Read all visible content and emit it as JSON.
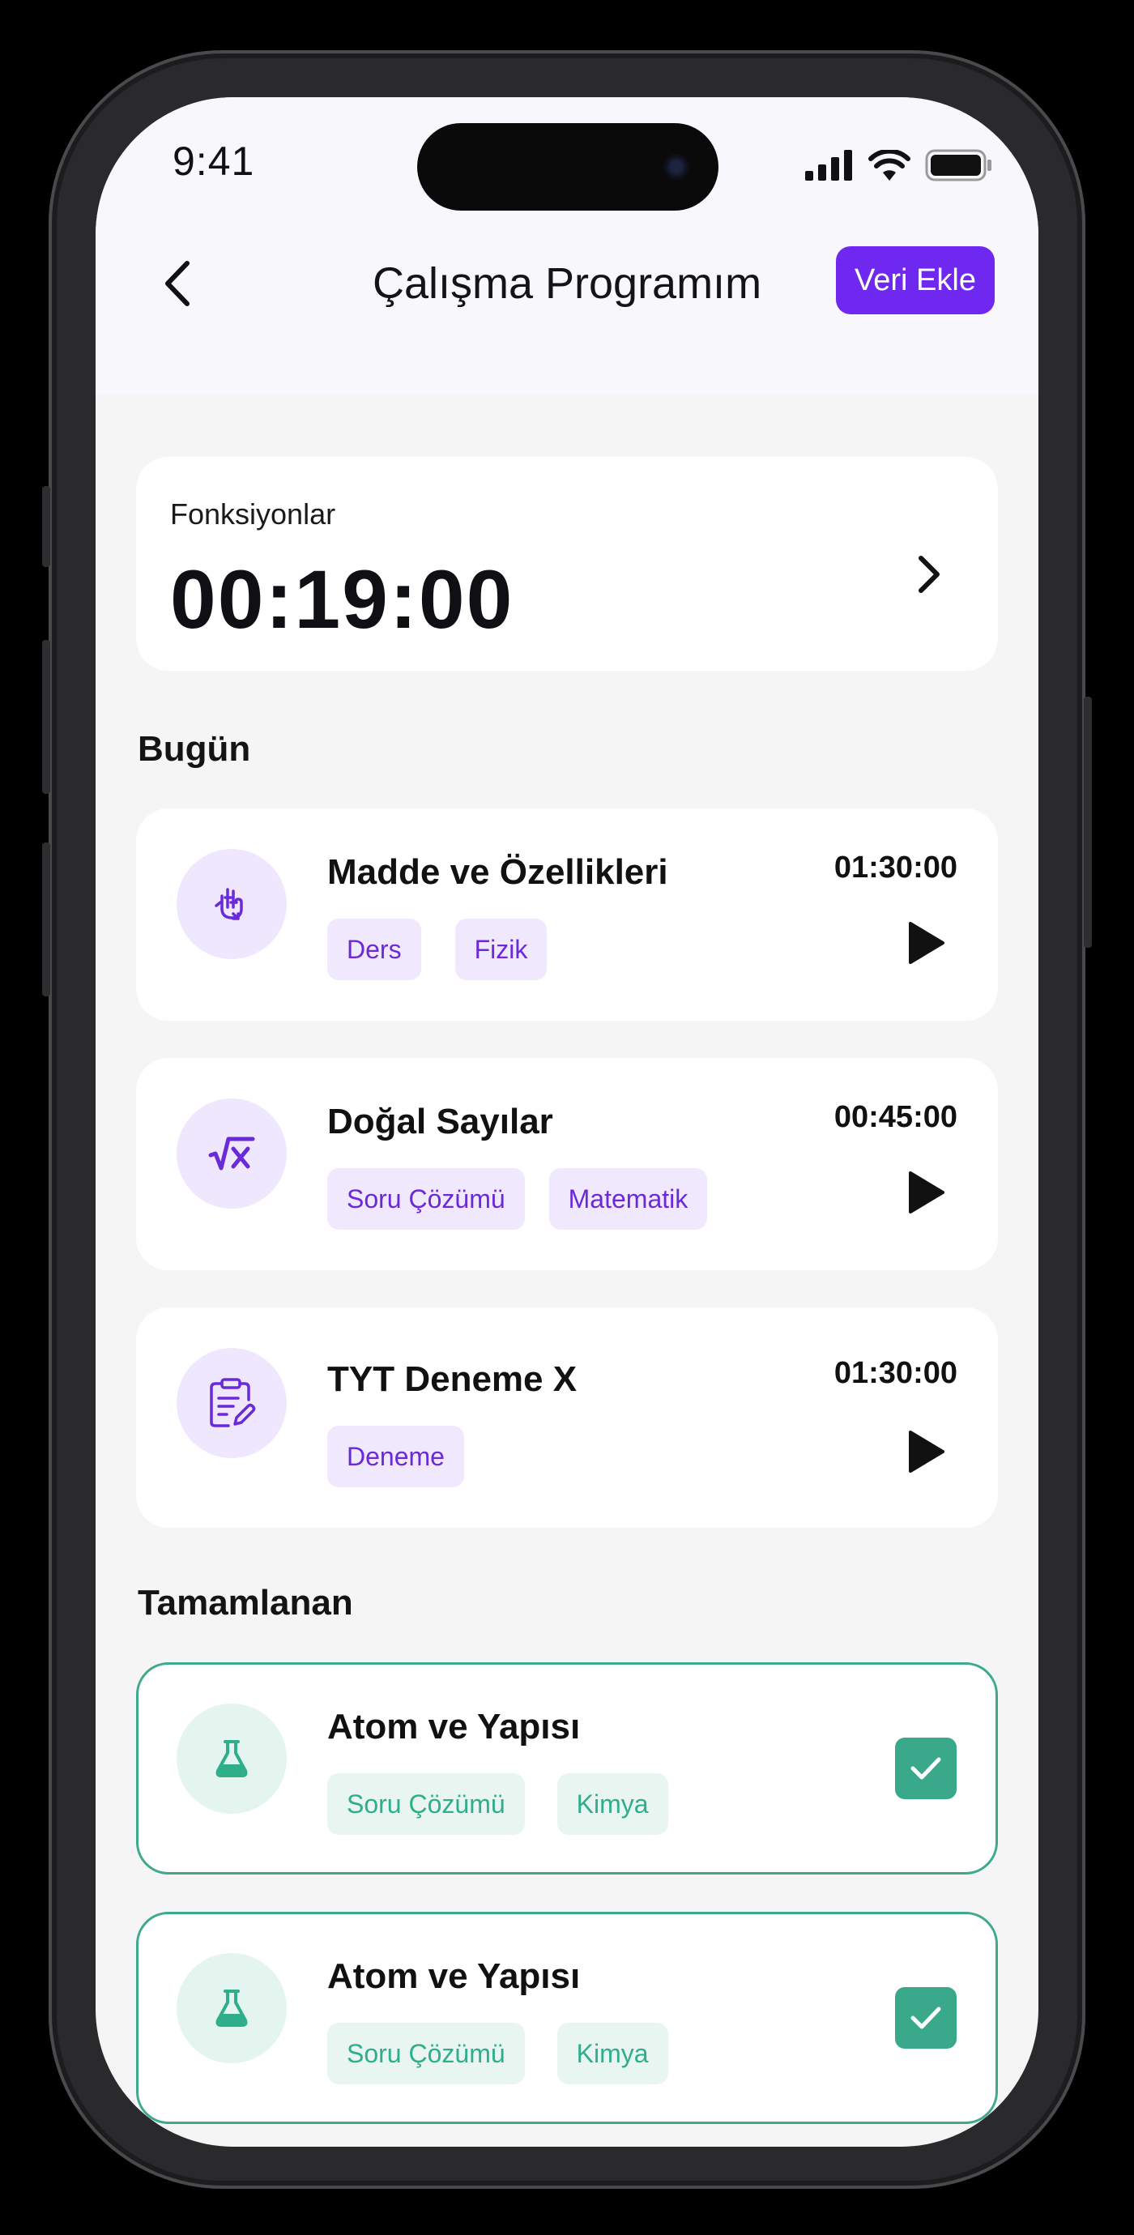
{
  "status_bar": {
    "time": "9:41"
  },
  "header": {
    "title": "Çalışma Programım",
    "add_label": "Veri Ekle"
  },
  "timer_card": {
    "label": "Fonksiyonlar",
    "value": "00:19:00"
  },
  "today": {
    "title": "Bugün",
    "items": [
      {
        "title": "Madde ve Özellikleri",
        "time": "01:30:00",
        "icon": "physics-hand-icon",
        "tags": [
          "Ders",
          "Fizik"
        ]
      },
      {
        "title": "Doğal Sayılar",
        "time": "00:45:00",
        "icon": "square-root-icon",
        "tags": [
          "Soru Çözümü",
          "Matematik"
        ]
      },
      {
        "title": "TYT Deneme X",
        "time": "01:30:00",
        "icon": "clipboard-edit-icon",
        "tags": [
          "Deneme"
        ]
      }
    ]
  },
  "completed": {
    "title": "Tamamlanan",
    "items": [
      {
        "title": "Atom ve Yapısı",
        "icon": "flask-icon",
        "tags": [
          "Soru Çözümü",
          "Kimya"
        ],
        "done": true
      },
      {
        "title": "Atom ve Yapısı",
        "icon": "flask-icon",
        "tags": [
          "Soru Çözümü",
          "Kimya"
        ],
        "done": true
      }
    ]
  },
  "colors": {
    "accent": "#6e28f0",
    "success": "#3aa88b",
    "tag_purple_bg": "#f0e8fd",
    "tag_green_bg": "#e8f5f0"
  }
}
